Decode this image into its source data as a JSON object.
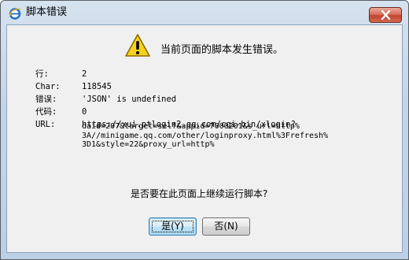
{
  "window": {
    "title": "脚本错误",
    "icons": {
      "app": "ie-logo-icon",
      "close": "close-icon"
    }
  },
  "message": {
    "headline": "当前页面的脚本发生错误。",
    "icon": "warning-icon"
  },
  "details": [
    {
      "label": "行:",
      "value": "2"
    },
    {
      "label": "Char:",
      "value": "118545"
    },
    {
      "label": "错误:",
      "value": "'JSON' is undefined"
    },
    {
      "label": "代码:",
      "value": "0"
    },
    {
      "label": "URL:",
      "value": "https://xui.ptlogin2.qq.com/cgi-bin/xlogin?"
    }
  ],
  "url_continuation": [
    "daid=207&target=self&appid=7000201&s_url=http%",
    "3A//minigame.qq.com/other/loginproxy.html%3Frefresh%",
    "3D1&style=22&proxy_url=http%"
  ],
  "question": "是否要在此页面上继续运行脚本?",
  "buttons": {
    "yes": "是(Y)",
    "no": "否(N)"
  },
  "colors": {
    "close_button": "#c0442f",
    "warning_yellow": "#f5d31c",
    "default_button_border": "#3c7fb1"
  }
}
